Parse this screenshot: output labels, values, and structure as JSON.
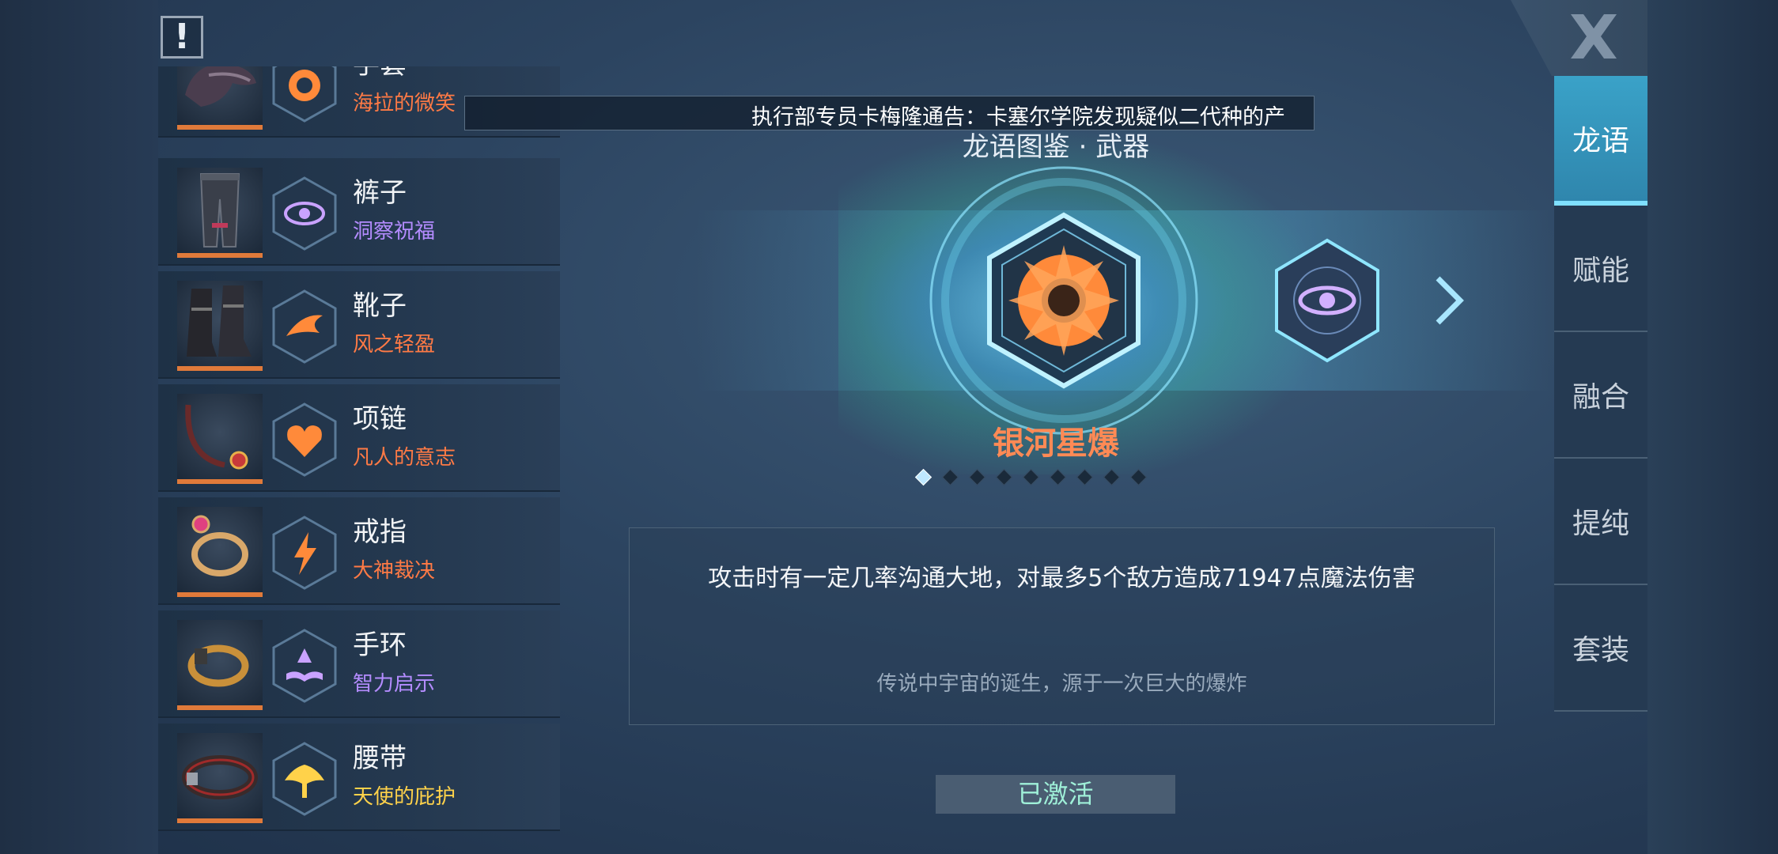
{
  "header": {
    "info_icon": "exclamation-icon",
    "close_icon": "close-x-icon",
    "notice": "执行部专员卡梅隆通告：卡塞尔学院发现疑似二代种的产"
  },
  "equipment": [
    {
      "slot": "手套",
      "rune": "海拉的微笑",
      "rune_color": "#ff7a45",
      "item_icon": "glove-icon",
      "rune_icon": "face-rune-icon"
    },
    {
      "slot": "裤子",
      "rune": "洞察祝福",
      "rune_color": "#b48cff",
      "item_icon": "pants-icon",
      "rune_icon": "eye-rune-icon"
    },
    {
      "slot": "靴子",
      "rune": "风之轻盈",
      "rune_color": "#ff7a45",
      "item_icon": "boots-icon",
      "rune_icon": "wind-rune-icon"
    },
    {
      "slot": "项链",
      "rune": "凡人的意志",
      "rune_color": "#ff7a45",
      "item_icon": "necklace-icon",
      "rune_icon": "heart-rune-icon"
    },
    {
      "slot": "戒指",
      "rune": "大神裁决",
      "rune_color": "#ff7a45",
      "item_icon": "ring-icon",
      "rune_icon": "lightning-rune-icon"
    },
    {
      "slot": "手环",
      "rune": "智力启示",
      "rune_color": "#b48cff",
      "item_icon": "bracelet-icon",
      "rune_icon": "book-rune-icon"
    },
    {
      "slot": "腰带",
      "rune": "天使的庇护",
      "rune_color": "#ffd24a",
      "item_icon": "belt-icon",
      "rune_icon": "wings-rune-icon"
    }
  ],
  "codex": {
    "title": "龙语图鉴 · 武器",
    "current_rune": "银河星爆",
    "current_rune_icon": "starburst-rune-icon",
    "next_rune_icon": "eye-rune-icon",
    "page_index": 1,
    "page_count": 9,
    "description": "攻击时有一定几率沟通大地，对最多5个敌方造成71947点魔法伤害",
    "flavor": "传说中宇宙的诞生，源于一次巨大的爆炸",
    "status_button": "已激活"
  },
  "tabs": [
    {
      "label": "龙语",
      "active": true
    },
    {
      "label": "赋能",
      "active": false
    },
    {
      "label": "融合",
      "active": false
    },
    {
      "label": "提纯",
      "active": false
    },
    {
      "label": "套装",
      "active": false
    }
  ]
}
